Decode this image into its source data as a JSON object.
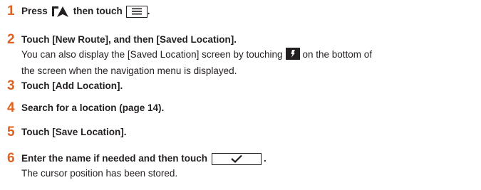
{
  "steps": [
    {
      "num": "1",
      "text_before": "Press",
      "icon1": "navigation-arrow-icon",
      "text_mid": "then touch",
      "icon2": "menu-list-icon",
      "text_after": "."
    },
    {
      "num": "2",
      "text": "Touch [New Route], and then [Saved Location].",
      "desc_line1_before": "You can also display the [Saved Location] screen by touching",
      "desc_icon": "saved-location-icon",
      "desc_line1_after": "on the bottom of",
      "desc_line2": "the screen when the navigation menu is displayed."
    },
    {
      "num": "3",
      "text": "Touch [Add Location]."
    },
    {
      "num": "4",
      "text": "Search for a location (page 14)."
    },
    {
      "num": "5",
      "text": "Touch [Save Location]."
    },
    {
      "num": "6",
      "text_before": "Enter the name if needed and then touch",
      "icon": "checkmark-icon",
      "text_after": ".",
      "desc": "The cursor position has been stored."
    }
  ],
  "colors": {
    "step_number": "#e0611f",
    "text": "#231f20",
    "background": "#ffffff"
  }
}
